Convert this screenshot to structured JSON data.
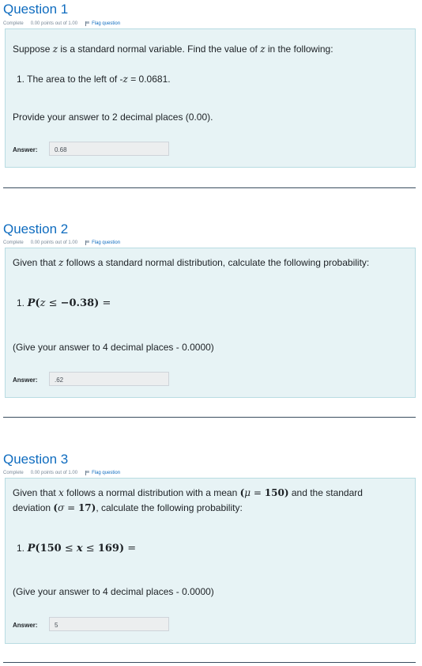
{
  "questions": [
    {
      "title": "Question 1",
      "status": "Complete",
      "points": "0.00 points out of 1.00",
      "flag": "Flag question",
      "intro_pre": "Suppose ",
      "intro_var": "z",
      "intro_mid": " is a standard normal variable. Find the value of ",
      "intro_var2": "z",
      "intro_post": " in the following:",
      "item_pre": "1. The area to the left of -",
      "item_var": "z",
      "item_post": " = 0.0681.",
      "note": "Provide your answer to 2 decimal places (0.00).",
      "answer_label": "Answer:",
      "answer_value": "0.68"
    },
    {
      "title": "Question 2",
      "status": "Complete",
      "points": "0.00 points out of 1.00",
      "flag": "Flag question",
      "intro_pre": "Given that ",
      "intro_var": "z",
      "intro_post": " follows a standard normal distribution, calculate the following probability:",
      "item_num": "1.",
      "item_P": "P",
      "item_open": "(",
      "item_var": "z",
      "item_op": " ≤ ",
      "item_val": "−0.38",
      "item_close": ")",
      "item_eq": " =",
      "note": "(Give your answer to 4 decimal places - 0.0000)",
      "answer_label": "Answer:",
      "answer_value": ".62"
    },
    {
      "title": "Question 3",
      "status": "Complete",
      "points": "0.00 points out of 1.00",
      "flag": "Flag question",
      "intro_pre": "Given that ",
      "intro_var": "x",
      "intro_mid": " follows a normal distribution with a mean ",
      "mean_open": "(",
      "mean_sym": "μ",
      "mean_eq": " = ",
      "mean_val": "150",
      "mean_close": ")",
      "intro_mid2": " and the standard",
      "line2_pre": "deviation ",
      "sd_open": "(",
      "sd_sym": "σ",
      "sd_eq": " = ",
      "sd_val": "17",
      "sd_close": ")",
      "line2_post": ", calculate the following probability:",
      "item_num": "1.",
      "item_P": "P",
      "item_open": "(",
      "item_a": "150",
      "item_op1": " ≤ ",
      "item_var": "x",
      "item_op2": " ≤ ",
      "item_b": "169",
      "item_close": ")",
      "item_eq": " =",
      "note": "(Give your answer to 4 decimal places - 0.0000)",
      "answer_label": "Answer:",
      "answer_value": "5"
    }
  ],
  "colors": {
    "title": "#0f6cbf",
    "box_bg": "#e7f3f5",
    "box_border": "#b8dce2",
    "separator": "#3a4d5f"
  }
}
